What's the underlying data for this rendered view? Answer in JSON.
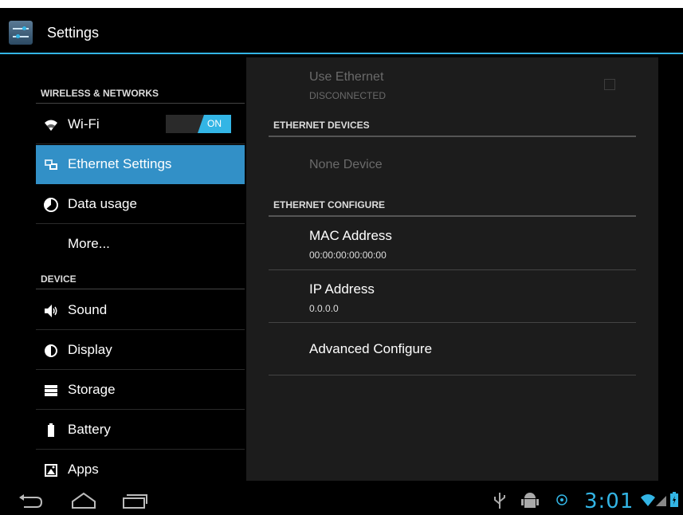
{
  "app": {
    "title": "Settings"
  },
  "sidebar": {
    "categories": {
      "wireless": "WIRELESS & NETWORKS",
      "device": "DEVICE"
    },
    "items": [
      {
        "label": "Wi-Fi",
        "icon": "wifi-icon",
        "toggle": "ON"
      },
      {
        "label": "Ethernet Settings",
        "icon": "ethernet-icon",
        "selected": true
      },
      {
        "label": "Data usage",
        "icon": "data-usage-icon"
      },
      {
        "label": "More..."
      },
      {
        "label": "Sound",
        "icon": "speaker-icon"
      },
      {
        "label": "Display",
        "icon": "display-icon"
      },
      {
        "label": "Storage",
        "icon": "storage-icon"
      },
      {
        "label": "Battery",
        "icon": "battery-icon"
      },
      {
        "label": "Apps",
        "icon": "apps-icon"
      }
    ]
  },
  "ethernet": {
    "use_title": "Use Ethernet",
    "use_status": "DISCONNECTED",
    "devices_header": "ETHERNET DEVICES",
    "none_device": "None Device",
    "configure_header": "ETHERNET CONFIGURE",
    "mac_title": "MAC Address",
    "mac_value": "00:00:00:00:00:00",
    "ip_title": "IP Address",
    "ip_value": "0.0.0.0",
    "advanced": "Advanced Configure"
  },
  "statusbar": {
    "time": "3:01"
  },
  "colors": {
    "accent": "#33b5e5",
    "selected": "#3290c7",
    "background": "#000000",
    "panel": "#1c1c1c"
  }
}
